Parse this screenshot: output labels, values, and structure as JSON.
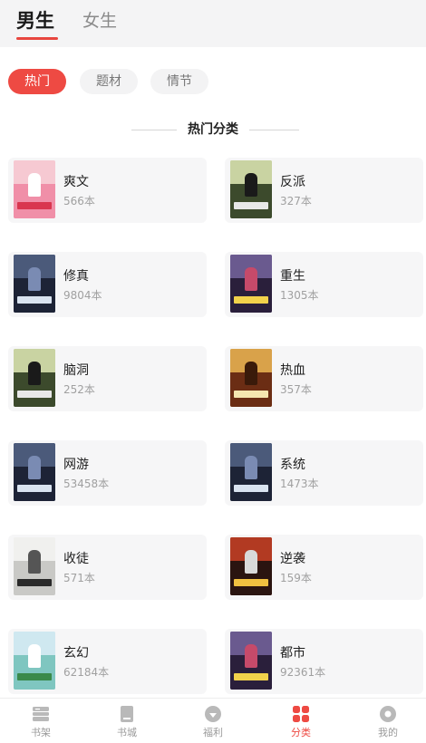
{
  "gender_tabs": {
    "male": "男生",
    "female": "女生"
  },
  "filter_chips": [
    "热门",
    "题材",
    "情节"
  ],
  "section_title": "热门分类",
  "categories": [
    {
      "name": "爽文",
      "count": "566本",
      "cover": "pink"
    },
    {
      "name": "反派",
      "count": "327本",
      "cover": "green-dark"
    },
    {
      "name": "修真",
      "count": "9804本",
      "cover": "navy"
    },
    {
      "name": "重生",
      "count": "1305本",
      "cover": "purple-dark"
    },
    {
      "name": "脑洞",
      "count": "252本",
      "cover": "green-dark"
    },
    {
      "name": "热血",
      "count": "357本",
      "cover": "gold"
    },
    {
      "name": "网游",
      "count": "53458本",
      "cover": "navy"
    },
    {
      "name": "系统",
      "count": "1473本",
      "cover": "navy"
    },
    {
      "name": "收徒",
      "count": "571本",
      "cover": "ink"
    },
    {
      "name": "逆袭",
      "count": "159本",
      "cover": "red-dark"
    },
    {
      "name": "玄幻",
      "count": "62184本",
      "cover": "teal-light"
    },
    {
      "name": "都市",
      "count": "92361本",
      "cover": "purple-dark"
    }
  ],
  "bottom_nav": [
    {
      "label": "书架",
      "icon": "bookshelf-icon"
    },
    {
      "label": "书城",
      "icon": "book-icon"
    },
    {
      "label": "福利",
      "icon": "gift-icon"
    },
    {
      "label": "分类",
      "icon": "category-grid-icon"
    },
    {
      "label": "我的",
      "icon": "profile-icon"
    }
  ],
  "colors": {
    "accent": "#ee4a43",
    "card_bg": "#f6f6f7",
    "topbar_bg": "#f4f4f5",
    "muted_text": "#a0a0a0"
  }
}
